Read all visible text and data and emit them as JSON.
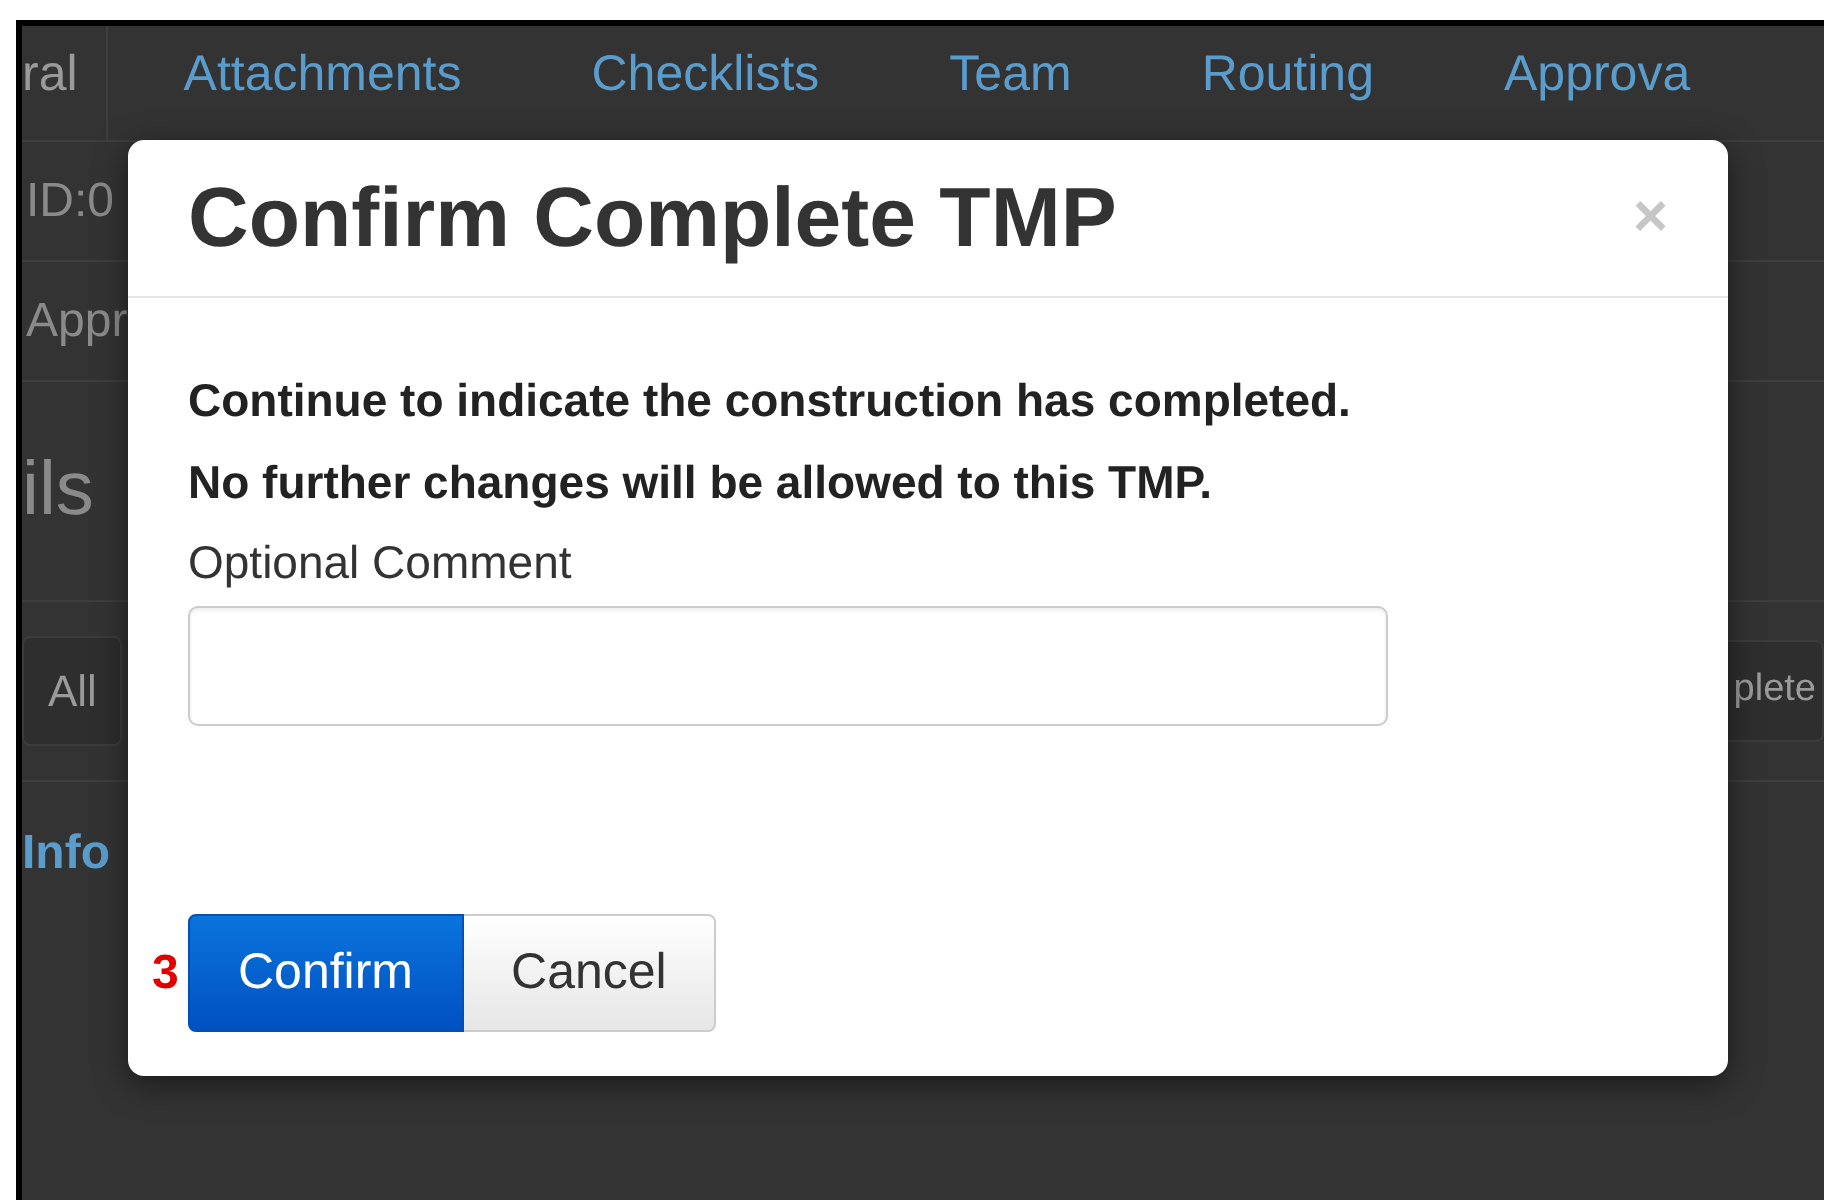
{
  "background_page": {
    "tabs": [
      {
        "label": "ral",
        "selected": true
      },
      {
        "label": "Attachments",
        "selected": false
      },
      {
        "label": "Checklists",
        "selected": false
      },
      {
        "label": "Team",
        "selected": false
      },
      {
        "label": "Routing",
        "selected": false
      },
      {
        "label": "Approva",
        "selected": false
      }
    ],
    "fields": [
      "ID:0",
      "Appr"
    ],
    "heading": "ils",
    "buttons": [
      "All",
      "plete"
    ],
    "section_link": "Info"
  },
  "modal": {
    "title": "Confirm Complete TMP",
    "close": "×",
    "message": [
      "Continue to indicate the construction has completed.",
      "No further changes will be allowed to this TMP."
    ],
    "comment_label": "Optional Comment",
    "buttons": [
      {
        "label": "Confirm",
        "kind": "primary"
      },
      {
        "label": "Cancel",
        "kind": "default"
      }
    ]
  },
  "annotation": "3"
}
